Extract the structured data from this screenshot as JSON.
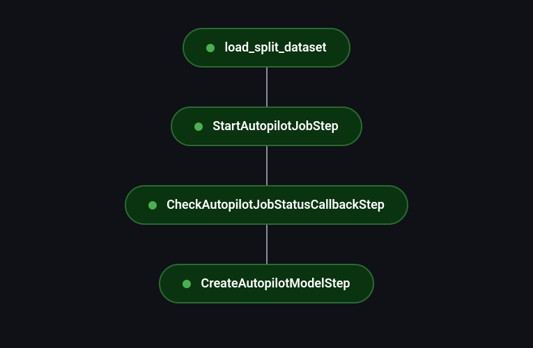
{
  "pipeline": {
    "nodes": [
      {
        "label": "load_split_dataset",
        "status": "success",
        "name": "node-load-split-dataset"
      },
      {
        "label": "StartAutopilotJobStep",
        "status": "success",
        "name": "node-start-autopilot-job-step"
      },
      {
        "label": "CheckAutopilotJobStatusCallbackStep",
        "status": "success",
        "name": "node-check-autopilot-job-status-callback-step"
      },
      {
        "label": "CreateAutopilotModelStep",
        "status": "success",
        "name": "node-create-autopilot-model-step"
      }
    ]
  },
  "colors": {
    "background": "#0f1117",
    "node_fill": "#0a3310",
    "node_border": "#2a6b32",
    "status_success": "#4caf50",
    "connector": "#8a8f99",
    "text": "#ffffff"
  }
}
